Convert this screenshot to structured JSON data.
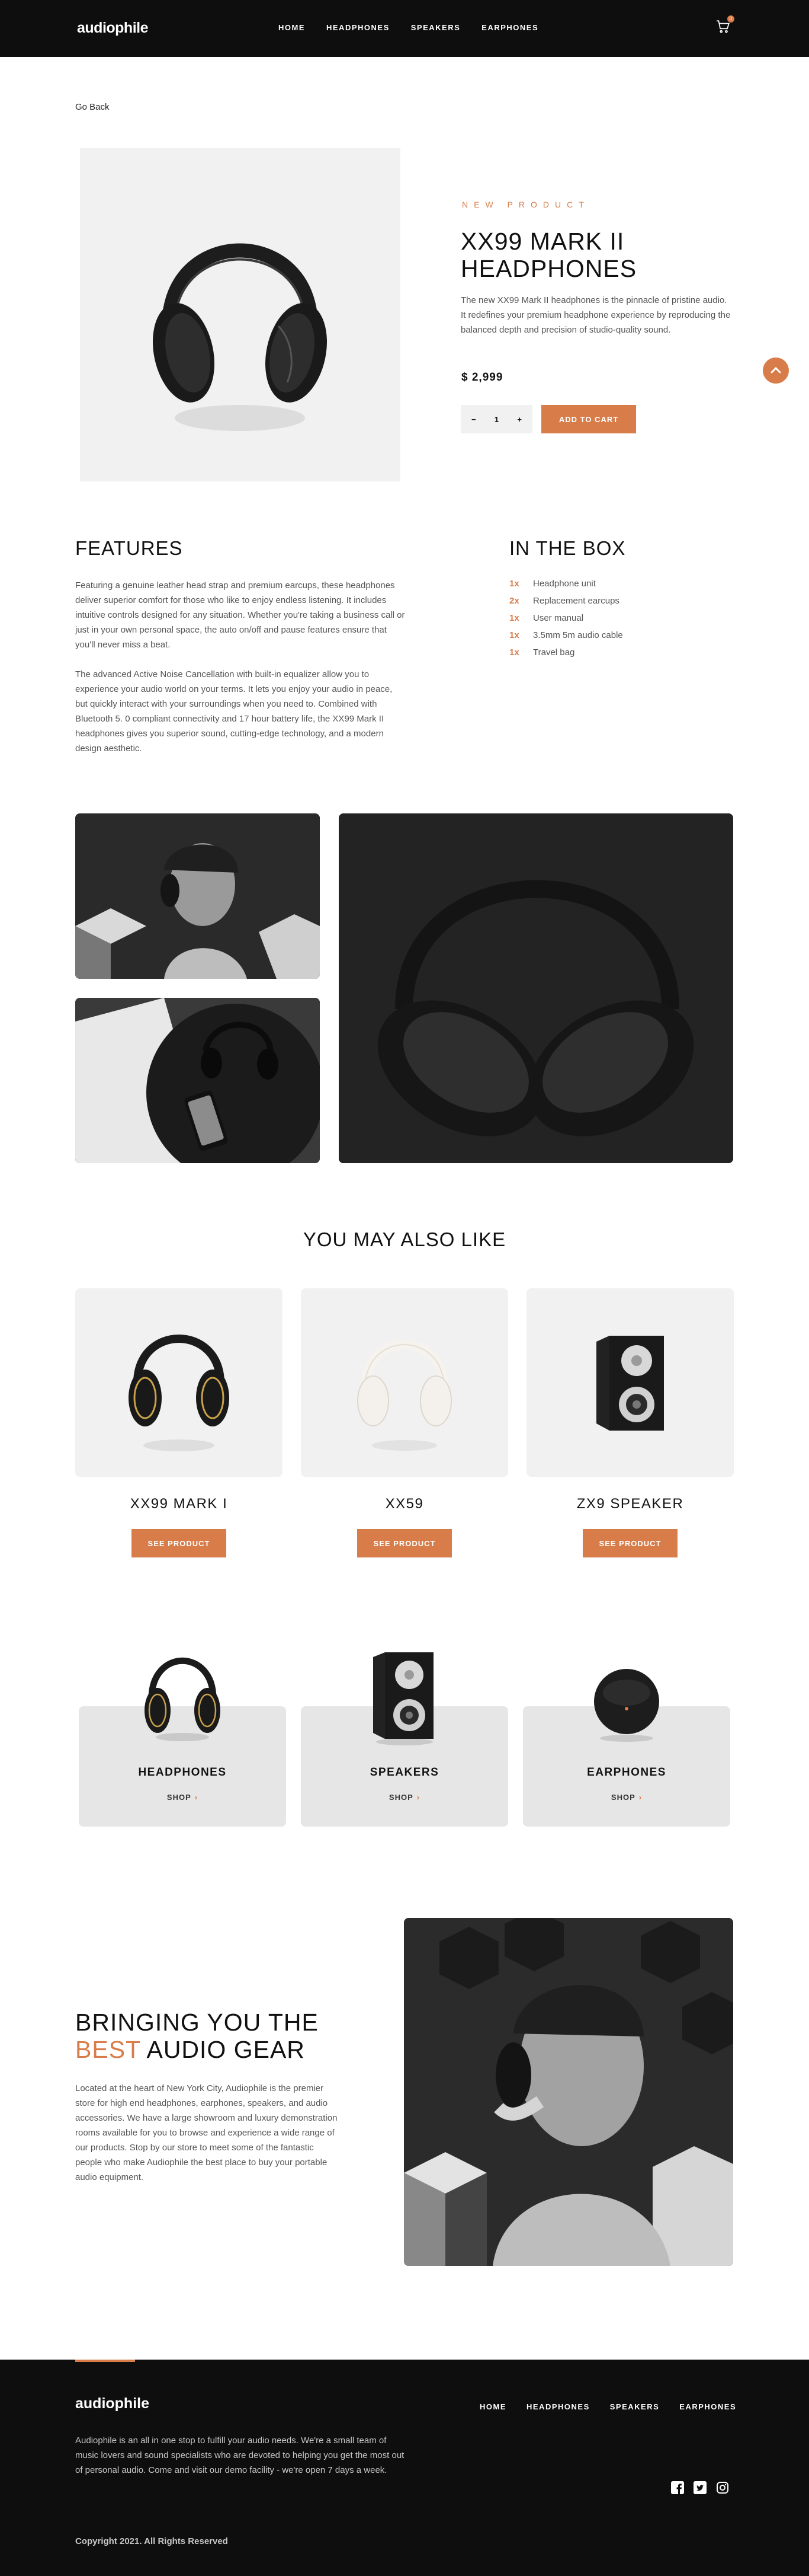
{
  "header": {
    "logo": "audiophile",
    "nav": [
      "HOME",
      "HEADPHONES",
      "SPEAKERS",
      "EARPHONES"
    ],
    "cart_count": "0",
    "cart_icon": "cart-icon"
  },
  "go_back": "Go Back",
  "product": {
    "overline": "NEW PRODUCT",
    "title": "XX99 MARK II HEADPHONES",
    "description": "The new XX99 Mark II headphones is the pinnacle of pristine audio. It redefines your premium headphone experience by reproducing the balanced depth and precision of studio-quality sound.",
    "price": "$ 2,999",
    "quantity": "1",
    "minus": "−",
    "plus": "+",
    "add_to_cart": "ADD TO CART"
  },
  "features": {
    "heading": "FEATURES",
    "p1": "Featuring a genuine leather head strap and premium earcups, these headphones deliver superior comfort for those who like to enjoy endless listening. It includes intuitive controls designed for any situation. Whether you're taking a business call or just in your own personal space, the auto on/off and pause features ensure that you'll never miss a beat.",
    "p2": "The advanced Active Noise Cancellation with built-in equalizer allow you to experience your audio world on your terms. It lets you enjoy your audio in peace, but quickly interact with your surroundings when you need to. Combined with Bluetooth 5. 0 compliant connectivity and 17 hour battery life, the XX99 Mark II headphones gives you superior sound, cutting-edge technology, and a modern design aesthetic."
  },
  "in_the_box": {
    "heading": "IN THE BOX",
    "items": [
      {
        "qty": "1x",
        "name": "Headphone unit"
      },
      {
        "qty": "2x",
        "name": "Replacement earcups"
      },
      {
        "qty": "1x",
        "name": "User manual"
      },
      {
        "qty": "1x",
        "name": "3.5mm 5m audio cable"
      },
      {
        "qty": "1x",
        "name": "Travel bag"
      }
    ]
  },
  "also_like": {
    "heading": "YOU MAY ALSO LIKE",
    "items": [
      {
        "name": "XX99 MARK I",
        "button": "SEE PRODUCT"
      },
      {
        "name": "XX59",
        "button": "SEE PRODUCT"
      },
      {
        "name": "ZX9 SPEAKER",
        "button": "SEE PRODUCT"
      }
    ]
  },
  "categories": [
    {
      "name": "HEADPHONES",
      "shop": "SHOP"
    },
    {
      "name": "SPEAKERS",
      "shop": "SHOP"
    },
    {
      "name": "EARPHONES",
      "shop": "SHOP"
    }
  ],
  "about": {
    "heading_a": "BRINGING YOU THE ",
    "heading_accent": "BEST",
    "heading_b": " AUDIO GEAR",
    "text": "Located at the heart of New York City, Audiophile is the premier store for high end headphones, earphones, speakers, and audio accessories. We have a large showroom and luxury demonstration rooms available for you to browse and experience a wide range of our products. Stop by our store to meet some of the fantastic people who make Audiophile the best place to buy your portable audio equipment."
  },
  "footer": {
    "logo": "audiophile",
    "nav": [
      "HOME",
      "HEADPHONES",
      "SPEAKERS",
      "EARPHONES"
    ],
    "description": "Audiophile is an all in one stop to fulfill your audio needs. We're a small team of music lovers and sound specialists who are devoted to helping you get the most out of personal audio. Come and visit our demo facility - we're open 7 days a week.",
    "copyright": "Copyright 2021. All Rights Reserved",
    "socials": [
      "facebook-icon",
      "twitter-icon",
      "instagram-icon"
    ]
  },
  "colors": {
    "accent": "#d87d4a",
    "dark": "#0e0e0e",
    "light": "#f1f1f1"
  }
}
